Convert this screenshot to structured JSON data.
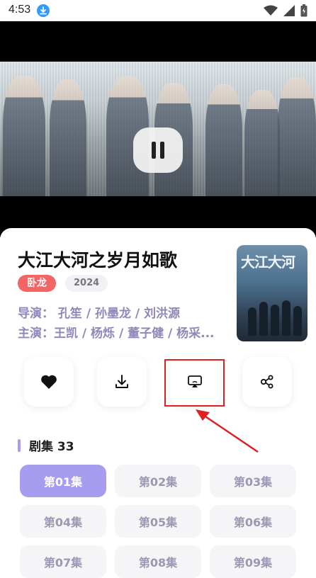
{
  "status_bar": {
    "time": "4:53",
    "icons": [
      "download-notification-icon",
      "wifi-icon",
      "signal-icon",
      "battery-icon"
    ]
  },
  "player": {
    "state": "paused-control-visible",
    "control_icon": "pause-icon"
  },
  "show": {
    "title": "大江大河之岁月如歌",
    "tag": "卧龙",
    "year": "2024",
    "director_line": "导演： 孔笙 / 孙墨龙 / 刘洪源",
    "cast_line": "主演：王凯 / 杨烁 / 董子健 / 杨采...",
    "poster_title": "大江大河"
  },
  "actions": [
    {
      "name": "favorite-button",
      "icon": "heart-icon"
    },
    {
      "name": "download-button",
      "icon": "download-icon"
    },
    {
      "name": "cast-screen-button",
      "icon": "screen-cast-icon"
    },
    {
      "name": "share-button",
      "icon": "share-icon"
    }
  ],
  "episodes": {
    "header": "剧集 33",
    "items": [
      "第01集",
      "第02集",
      "第03集",
      "第04集",
      "第05集",
      "第06集",
      "第07集",
      "第08集",
      "第09集"
    ],
    "selected": "第01集"
  },
  "colors": {
    "accent": "#a79df0",
    "tag_red": "#f36464",
    "meta_text": "#8f88b8",
    "highlight_red": "#e02020"
  }
}
